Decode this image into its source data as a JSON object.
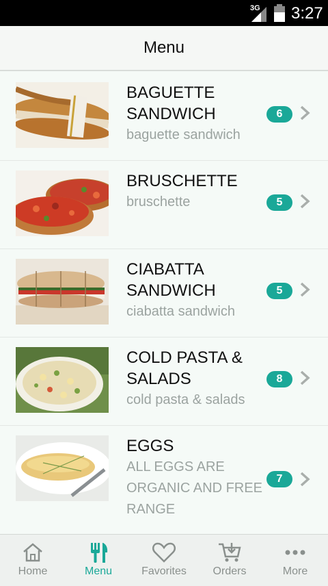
{
  "status_bar": {
    "network": "3G",
    "time": "3:27"
  },
  "header": {
    "title": "Menu"
  },
  "menu_items": [
    {
      "title": "BAGUETTE SANDWICH",
      "subtitle": "baguette sandwich",
      "count": "6"
    },
    {
      "title": "BRUSCHETTE",
      "subtitle": "bruschette",
      "count": "5"
    },
    {
      "title": "CIABATTA SANDWICH",
      "subtitle": "ciabatta sandwich",
      "count": "5"
    },
    {
      "title": "COLD PASTA & SALADS",
      "subtitle": "cold pasta & salads",
      "count": "8"
    },
    {
      "title": "EGGS",
      "subtitle": "ALL EGGS ARE ORGANIC AND FREE RANGE",
      "count": "7"
    }
  ],
  "tab_bar": {
    "tabs": [
      {
        "label": "Home",
        "icon": "home-icon"
      },
      {
        "label": "Menu",
        "icon": "fork-knife-icon"
      },
      {
        "label": "Favorites",
        "icon": "heart-icon"
      },
      {
        "label": "Orders",
        "icon": "cart-icon"
      },
      {
        "label": "More",
        "icon": "more-dots-icon"
      }
    ],
    "active": "Menu"
  },
  "colors": {
    "accent": "#1aa898",
    "status_bar": "#000000",
    "inactive_tab": "#8a908d"
  }
}
